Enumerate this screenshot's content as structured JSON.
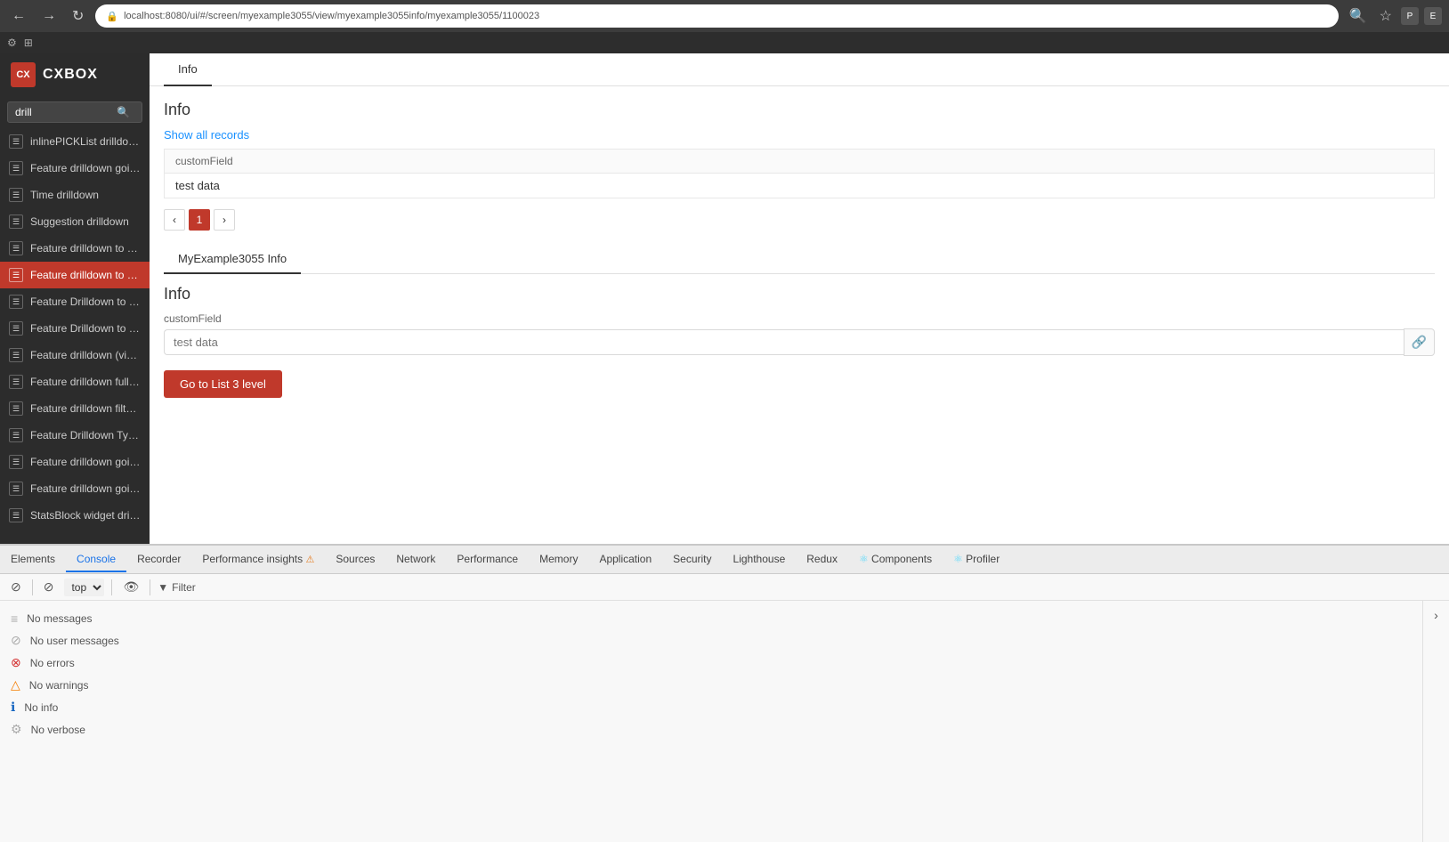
{
  "browser": {
    "url": "localhost:8080/ui/#/screen/myexample3055/view/myexample3055info/myexample3055/1100023",
    "back_btn": "←",
    "forward_btn": "→",
    "reload_btn": "↻"
  },
  "sidebar": {
    "logo_text": "CXBOX",
    "search_placeholder": "drill",
    "items": [
      {
        "label": "inlinePICKList drilldown",
        "active": false
      },
      {
        "label": "Feature drilldown going b",
        "active": false
      },
      {
        "label": "Time drilldown",
        "active": false
      },
      {
        "label": "Suggestion drilldown",
        "active": false
      },
      {
        "label": "Feature drilldown to scre",
        "active": false
      },
      {
        "label": "Feature drilldown to othe",
        "active": true
      },
      {
        "label": "Feature Drilldown to view",
        "active": false
      },
      {
        "label": "Feature Drilldown to view",
        "active": false
      },
      {
        "label": "Feature drilldown (visuall",
        "active": false
      },
      {
        "label": "Feature drilldown fullText",
        "active": false
      },
      {
        "label": "Feature drilldown filter gr",
        "active": false
      },
      {
        "label": "Feature Drilldown Types",
        "active": false
      },
      {
        "label": "Feature drilldown going f",
        "active": false
      },
      {
        "label": "Feature drilldown going b",
        "active": false
      },
      {
        "label": "StatsBlock widget drilldo",
        "active": false
      }
    ]
  },
  "main_tab": {
    "label": "Info"
  },
  "info_section": {
    "title": "Info",
    "show_all_label": "Show all records",
    "table_header": "customField",
    "table_row": "test data",
    "pagination": {
      "prev": "‹",
      "current": "1",
      "next": "›"
    }
  },
  "sub_tab": {
    "label": "MyExample3055 Info"
  },
  "form_section": {
    "title": "Info",
    "field_label": "customField",
    "field_value": "test data",
    "field_placeholder": "test data",
    "link_icon": "🔗",
    "go_button_label": "Go to List 3 level"
  },
  "devtools": {
    "tabs": [
      {
        "label": "Elements",
        "active": false
      },
      {
        "label": "Console",
        "active": true
      },
      {
        "label": "Recorder",
        "active": false
      },
      {
        "label": "Performance insights",
        "active": false,
        "has_warning": true
      },
      {
        "label": "Sources",
        "active": false
      },
      {
        "label": "Network",
        "active": false
      },
      {
        "label": "Performance",
        "active": false
      },
      {
        "label": "Memory",
        "active": false
      },
      {
        "label": "Application",
        "active": false
      },
      {
        "label": "Security",
        "active": false
      },
      {
        "label": "Lighthouse",
        "active": false
      },
      {
        "label": "Redux",
        "active": false
      },
      {
        "label": "Components",
        "active": false,
        "has_react_icon": true
      },
      {
        "label": "Profiler",
        "active": false,
        "has_react_icon": true
      }
    ],
    "toolbar": {
      "clear_icon": "🚫",
      "top_level": "top",
      "eye_icon": "👁",
      "filter_label": "Filter"
    },
    "console_messages": [
      {
        "icon": "≡",
        "icon_type": "normal",
        "text": "No messages"
      },
      {
        "icon": "⊘",
        "icon_type": "normal",
        "text": "No user messages"
      },
      {
        "icon": "⊗",
        "icon_type": "error",
        "text": "No errors"
      },
      {
        "icon": "△",
        "icon_type": "warning",
        "text": "No warnings"
      },
      {
        "icon": "ℹ",
        "icon_type": "info",
        "text": "No info"
      },
      {
        "icon": "⚙",
        "icon_type": "normal",
        "text": "No verbose"
      }
    ]
  }
}
